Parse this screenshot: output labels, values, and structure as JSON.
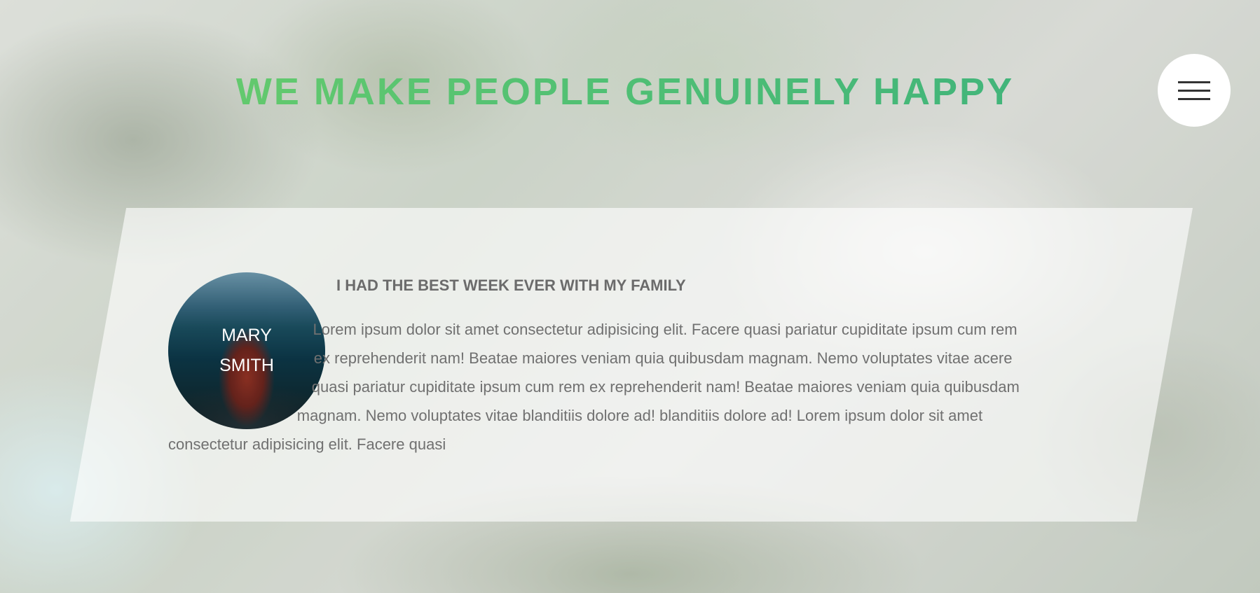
{
  "hero": {
    "headline": "WE MAKE PEOPLE GENUINELY HAPPY",
    "gradient_start": "#6fcf6a",
    "gradient_end": "#3aae7e"
  },
  "nav": {
    "menu_icon": "hamburger-menu-icon"
  },
  "testimonial": {
    "author_line1": "MARY",
    "author_line2": "SMITH",
    "title": "I HAD THE BEST WEEK EVER WITH MY FAMILY",
    "body": "Lorem ipsum dolor sit amet consectetur adipisicing elit. Facere quasi pariatur cupiditate ipsum cum rem ex reprehenderit nam! Beatae maiores veniam quia quibusdam magnam. Nemo voluptates vitae acere quasi pariatur cupiditate ipsum cum rem ex reprehenderit nam! Beatae maiores veniam quia quibusdam magnam. Nemo voluptates vitae blanditiis dolore ad! blanditiis dolore ad! Lorem ipsum dolor sit amet consectetur adipisicing elit. Facere quasi"
  }
}
